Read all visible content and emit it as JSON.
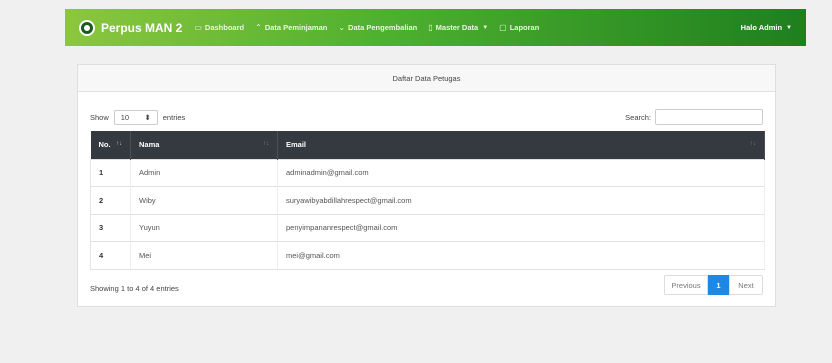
{
  "navbar": {
    "brand": "Perpus MAN 2",
    "items": [
      {
        "icon": "▭",
        "icon_name": "dashboard-icon",
        "label": "Dashboard",
        "caret": ""
      },
      {
        "icon": "⌃",
        "icon_name": "borrow-icon",
        "label": "Data Peminjaman",
        "caret": ""
      },
      {
        "icon": "⌄",
        "icon_name": "return-icon",
        "label": "Data Pengembalian",
        "caret": ""
      },
      {
        "icon": "▯",
        "icon_name": "master-data-icon",
        "label": "Master Data",
        "caret": "▼"
      },
      {
        "icon": "▢",
        "icon_name": "report-icon",
        "label": "Laporan",
        "caret": ""
      }
    ],
    "user": "Halo Admin",
    "user_caret": "▼"
  },
  "card": {
    "title": "Daftar Data Petugas"
  },
  "controls": {
    "show_label": "Show",
    "entries_value": "10",
    "select_arrow": "⬍",
    "entries_label": "entries",
    "search_label": "Search:",
    "search_value": ""
  },
  "table": {
    "columns": [
      {
        "label": "No.",
        "sort": "↑↓"
      },
      {
        "label": "Nama",
        "sort": "↑↓"
      },
      {
        "label": "Email",
        "sort": "↑↓"
      }
    ],
    "rows": [
      {
        "no": "1",
        "nama": "Admin",
        "email": "adminadmin@gmail.com"
      },
      {
        "no": "2",
        "nama": "Wiby",
        "email": "suryawibyabdillahrespect@gmail.com"
      },
      {
        "no": "3",
        "nama": "Yuyun",
        "email": "penyimpananrespect@gmail.com"
      },
      {
        "no": "4",
        "nama": "Mei",
        "email": "mei@gmail.com"
      }
    ]
  },
  "footer": {
    "info": "Showing 1 to 4 of 4 entries",
    "prev": "Previous",
    "current": "1",
    "next": "Next"
  },
  "colors": {
    "navbar_start": "#8cc63f",
    "navbar_end": "#1f7f1f",
    "table_header": "#353a40",
    "pager_active": "#1e88e5"
  }
}
